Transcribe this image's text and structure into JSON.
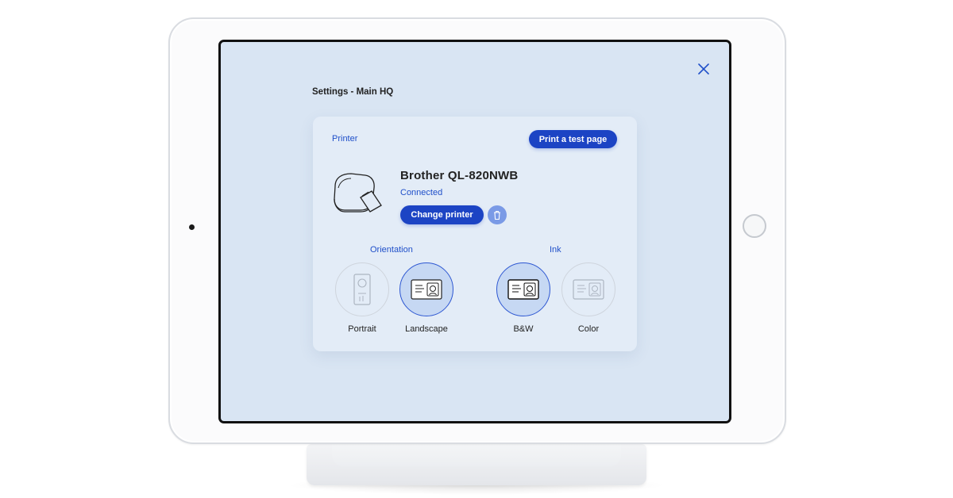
{
  "header": {
    "title": "Settings - Main HQ",
    "close_icon": "close-icon"
  },
  "printer": {
    "section_label": "Printer",
    "test_button_label": "Print a test page",
    "name": "Brother QL-820NWB",
    "status": "Connected",
    "change_button_label": "Change printer",
    "delete_icon": "trash-icon"
  },
  "orientation": {
    "label": "Orientation",
    "options": [
      {
        "label": "Portrait",
        "selected": false
      },
      {
        "label": "Landscape",
        "selected": true
      }
    ]
  },
  "ink": {
    "label": "Ink",
    "options": [
      {
        "label": "B&W",
        "selected": true
      },
      {
        "label": "Color",
        "selected": false
      }
    ]
  },
  "colors": {
    "accent": "#1c44c4",
    "screen_bg": "#d9e5f3",
    "card_bg": "#e3ecf7"
  }
}
